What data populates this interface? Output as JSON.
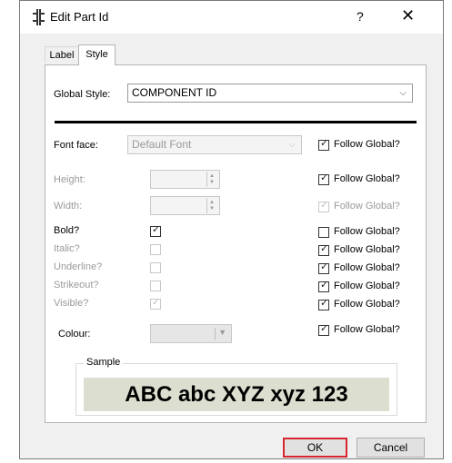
{
  "window": {
    "title": "Edit Part Id",
    "help_label": "?",
    "close_glyph": "✕",
    "app_icon": "part-id-icon"
  },
  "tabs": [
    {
      "label": "Label",
      "active": false
    },
    {
      "label": "Style",
      "active": true
    }
  ],
  "global_style": {
    "label": "Global Style:",
    "value": "COMPONENT ID"
  },
  "font_face": {
    "label": "Font face:",
    "value": "Default Font",
    "follow_global": true
  },
  "height": {
    "label": "Height:",
    "value": "",
    "follow_global": true
  },
  "width": {
    "label": "Width:",
    "value": "",
    "follow_global": true,
    "follow_disabled": true
  },
  "bold": {
    "label": "Bold?",
    "checked": true,
    "follow_global": false
  },
  "italic": {
    "label": "Italic?",
    "checked": false,
    "follow_global": true
  },
  "underline": {
    "label": "Underline?",
    "checked": false,
    "follow_global": true
  },
  "strikeout": {
    "label": "Strikeout?",
    "checked": false,
    "follow_global": true
  },
  "visible": {
    "label": "Visible?",
    "checked": true,
    "follow_global": true
  },
  "colour": {
    "label": "Colour:",
    "follow_global": true
  },
  "follow_global_label": "Follow Global?",
  "sample": {
    "legend": "Sample",
    "text": "ABC abc XYZ xyz 123",
    "background": "#dcdfcf"
  },
  "buttons": {
    "ok": "OK",
    "cancel": "Cancel"
  },
  "colors": {
    "ok_highlight": "#d9252f",
    "dialog_bg": "#f0f0f0"
  }
}
